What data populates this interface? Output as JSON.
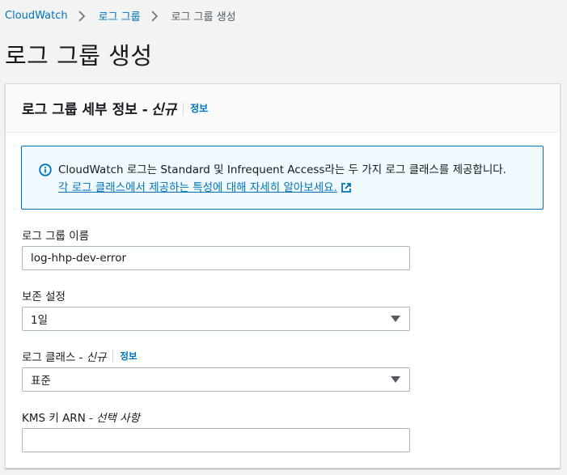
{
  "breadcrumb": {
    "items": [
      "CloudWatch",
      "로그 그룹",
      "로그 그룹 생성"
    ]
  },
  "page": {
    "title": "로그 그룹 생성"
  },
  "panel": {
    "title": "로그 그룹 세부 정보 -",
    "title_new": "신규",
    "info": "정보"
  },
  "alert": {
    "text": "CloudWatch 로그는 Standard 및 Infrequent Access라는 두 가지 로그 클래스를 제공합니다.",
    "link": "각 로그 클래스에서 제공하는 특성에 대해 자세히 알아보세요."
  },
  "form": {
    "log_group_name": {
      "label": "로그 그룹 이름",
      "value": "log-hhp-dev-error"
    },
    "retention": {
      "label": "보존 설정",
      "value": "1일"
    },
    "log_class": {
      "label": "로그 클래스 -",
      "label_new": "신규",
      "info": "정보",
      "value": "표준"
    },
    "kms": {
      "label": "KMS 키 ARN -",
      "label_optional": "선택 사항",
      "value": ""
    }
  },
  "colors": {
    "link": "#0073bb",
    "alert_bg": "#f1faff",
    "page_bg": "#f2f3f3"
  }
}
